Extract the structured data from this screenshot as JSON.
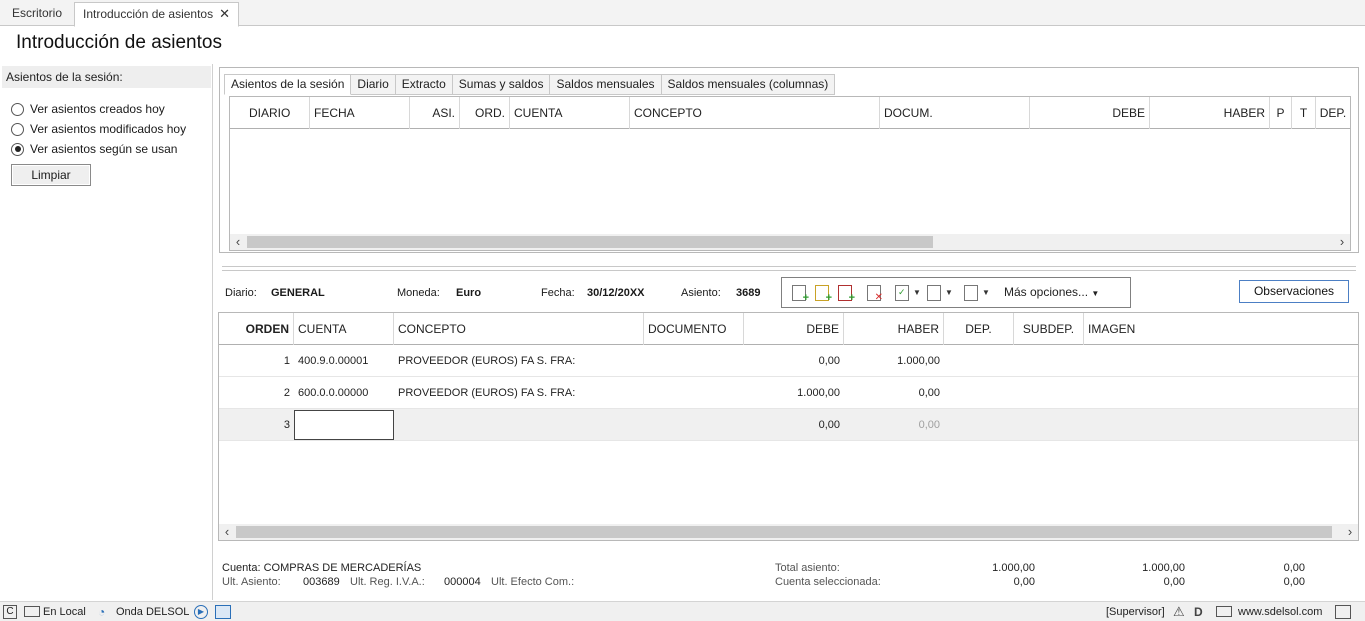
{
  "tabs": {
    "desktop": "Escritorio",
    "active": "Introducción de asientos",
    "close": "✕"
  },
  "page_title": "Introducción de asientos",
  "left": {
    "header": "Asientos de la sesión:",
    "options": [
      {
        "label": "Ver asientos creados hoy",
        "checked": false
      },
      {
        "label": "Ver asientos modificados hoy",
        "checked": false
      },
      {
        "label": "Ver asientos según se usan",
        "checked": true
      }
    ],
    "clear_button": "Limpiar"
  },
  "upper": {
    "tabs": [
      "Asientos de la sesión",
      "Diario",
      "Extracto",
      "Sumas y saldos",
      "Saldos mensuales",
      "Saldos mensuales (columnas)"
    ],
    "columns": [
      "DIARIO",
      "FECHA",
      "ASI.",
      "ORD.",
      "CUENTA",
      "CONCEPTO",
      "DOCUM.",
      "DEBE",
      "HABER",
      "P",
      "T",
      "DEP."
    ]
  },
  "info": {
    "diario_label": "Diario:",
    "diario": "GENERAL",
    "moneda_label": "Moneda:",
    "moneda": "Euro",
    "fecha_label": "Fecha:",
    "fecha": "30/12/20XX",
    "asiento_label": "Asiento:",
    "asiento": "3689",
    "more_options": "Más opciones...",
    "observaciones": "Observaciones"
  },
  "lower": {
    "columns": [
      "ORDEN",
      "CUENTA",
      "CONCEPTO",
      "DOCUMENTO",
      "DEBE",
      "HABER",
      "DEP.",
      "SUBDEP.",
      "IMAGEN"
    ],
    "rows": [
      {
        "orden": "1",
        "cuenta": "400.9.0.00001",
        "concepto": "PROVEEDOR (EUROS) FA S. FRA:",
        "documento": "",
        "debe": "0,00",
        "haber": "1.000,00"
      },
      {
        "orden": "2",
        "cuenta": "600.0.0.00000",
        "concepto": "PROVEEDOR (EUROS) FA S. FRA:",
        "documento": "",
        "debe": "1.000,00",
        "haber": "0,00"
      },
      {
        "orden": "3",
        "cuenta": "",
        "concepto": "",
        "documento": "",
        "debe": "0,00",
        "haber": "0,00"
      }
    ]
  },
  "footer": {
    "cuenta": "Cuenta: COMPRAS DE MERCADERÍAS",
    "ult_asiento_label": "Ult. Asiento:",
    "ult_asiento": "003689",
    "ult_reg_label": "Ult. Reg. I.V.A.:",
    "ult_reg": "000004",
    "ult_efecto_label": "Ult. Efecto Com.:",
    "total_label": "Total asiento:",
    "total_debe": "1.000,00",
    "total_haber": "1.000,00",
    "total_saldo": "0,00",
    "sel_label": "Cuenta seleccionada:",
    "sel_debe": "0,00",
    "sel_haber": "0,00",
    "sel_saldo": "0,00"
  },
  "status": {
    "local": "En Local",
    "onda": "Onda DELSOL",
    "user": "[Supervisor]",
    "web": "www.sdelsol.com"
  }
}
